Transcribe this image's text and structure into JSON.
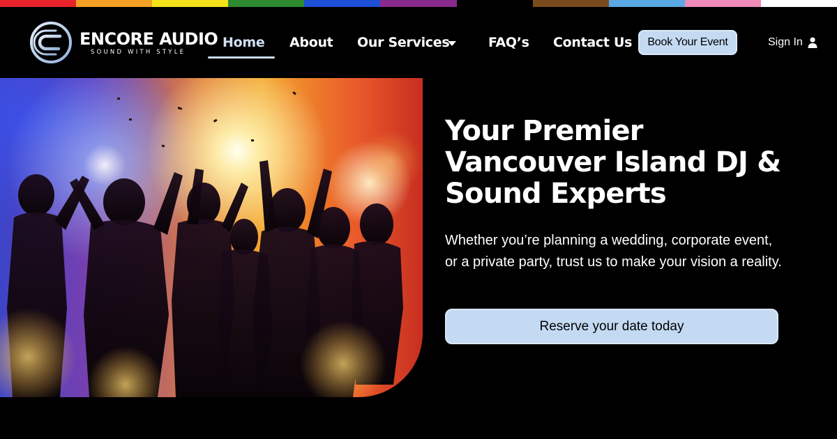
{
  "colors": {
    "rainbow": [
      "#e8242a",
      "#f4a024",
      "#f5e31a",
      "#2e8b2f",
      "#1e4fd8",
      "#8a2a8c",
      "#000000",
      "#7a4a1c",
      "#5aa8e6",
      "#f08ab8",
      "#ffffff"
    ],
    "accent": "#c4daf3",
    "background": "#000000"
  },
  "brand": {
    "name": "ENCORE AUDIO",
    "tagline": "SOUND WITH STYLE",
    "logo_icon": "encore-e-icon"
  },
  "nav": {
    "items": [
      {
        "label": "Home",
        "active": true
      },
      {
        "label": "About"
      },
      {
        "label": "Our Services",
        "icon": "chevron-down-icon"
      },
      {
        "label": "FAQ’s"
      },
      {
        "label": "Contact Us"
      }
    ],
    "book_button": "Book Your Event",
    "sign_in": "Sign In",
    "sign_in_icon": "user-icon"
  },
  "hero": {
    "title_lines": [
      "Your Premier",
      "Vancouver Island DJ &",
      "Sound Experts"
    ],
    "subtitle": "Whether you’re planning a wedding, corporate event, or a private party, trust us to make your vision a reality.",
    "cta": "Reserve your date today"
  }
}
